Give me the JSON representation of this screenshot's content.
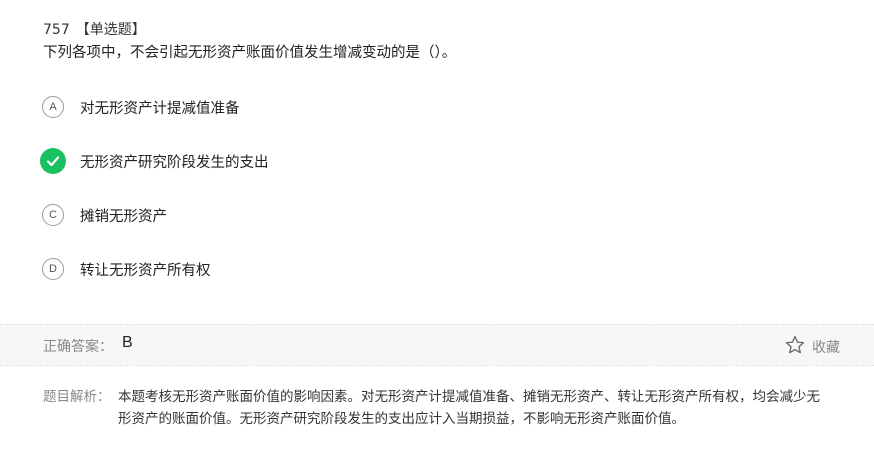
{
  "question": {
    "number": "757",
    "type": "【单选题】",
    "stem": "下列各项中，不会引起无形资产账面价值发生增减变动的是（）。"
  },
  "options": [
    {
      "letter": "A",
      "text": "对无形资产计提减值准备",
      "correct": false
    },
    {
      "letter": "B",
      "text": "无形资产研究阶段发生的支出",
      "correct": true
    },
    {
      "letter": "C",
      "text": "摊销无形资产",
      "correct": false
    },
    {
      "letter": "D",
      "text": "转让无形资产所有权",
      "correct": false
    }
  ],
  "answer": {
    "label": "正确答案：",
    "value": "B",
    "favorite_label": "收藏"
  },
  "analysis": {
    "label": "题目解析：",
    "text": "本题考核无形资产账面价值的影响因素。对无形资产计提减值准备、摊销无形资产、转让无形资产所有权，均会减少无形资产的账面价值。无形资产研究阶段发生的支出应计入当期损益，不影响无形资产账面价值。"
  },
  "colors": {
    "correct_green": "#19c160",
    "answer_bar_bg": "#f7f7f7",
    "muted_text": "#888888"
  },
  "icons": {
    "correct": "check-icon",
    "favorite": "star-outline-icon"
  }
}
